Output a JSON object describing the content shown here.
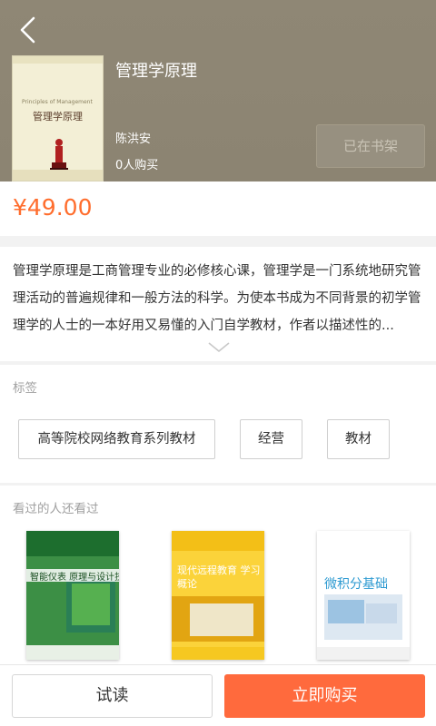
{
  "book": {
    "title": "管理学原理",
    "author": "陈洪安",
    "buyers": "0人购买",
    "shelf_button": "已在书架",
    "price": "¥49.00",
    "cover_title": "管理学原理",
    "cover_subtitle": "Principles of Management"
  },
  "description": {
    "text": "管理学原理是工商管理专业的必修核心课，管理学是一门系统地研究管理活动的普遍规律和一般方法的科学。为使本书成为不同背景的初学管理学的人士的一本好用又易懂的入门自学教材，作者以描述性的..."
  },
  "tags": {
    "title": "标签",
    "items": [
      "高等院校网络教育系列教材",
      "经营",
      "教材"
    ]
  },
  "recommendations": {
    "title": "看过的人还看过",
    "books": [
      {
        "cover_title": "智能仪表 原理与设计技术",
        "cover_color": "#2e7d3a"
      },
      {
        "cover_title": "现代远程教育 学习概论",
        "cover_color": "#f5c41a"
      },
      {
        "cover_title": "微积分基础",
        "cover_color": "#2d9ad1"
      }
    ]
  },
  "actions": {
    "try_read": "试读",
    "buy_now": "立即购买"
  },
  "colors": {
    "accent": "#ff6a3d",
    "price": "#ff6d2d",
    "header_bg": "#8f8775"
  },
  "icons": {
    "back": "back-arrow-icon",
    "expand": "chevron-down-icon"
  }
}
